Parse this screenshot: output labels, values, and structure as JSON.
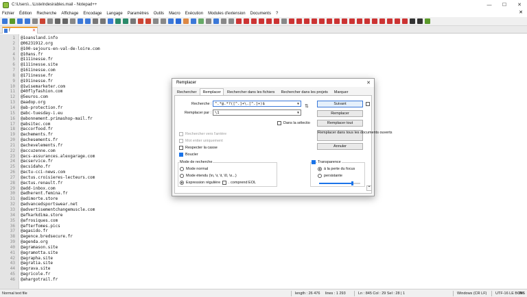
{
  "window": {
    "title": "C:\\Users\\...\\ListeIndesirables.mail - Notepad++",
    "minimize": "—",
    "maximize": "☐",
    "close": "✕"
  },
  "menu": [
    "Fichier",
    "Édition",
    "Recherche",
    "Affichage",
    "Encodage",
    "Langage",
    "Paramètres",
    "Outils",
    "Macro",
    "Exécution",
    "Modules d'extension",
    "Documents",
    "?"
  ],
  "menu_close": "✕",
  "tab": {
    "label": "f",
    "close": "✕"
  },
  "editor": {
    "lines": [
      {
        "n": "1",
        "t": "@1oansland.info"
      },
      {
        "n": "2",
        "t": "@06231912.org"
      },
      {
        "n": "3",
        "t": "@100-sejours-en-val-de-loire.com"
      },
      {
        "n": "4",
        "t": "@10ans.fr"
      },
      {
        "n": "5",
        "t": "@111inesse.fr"
      },
      {
        "n": "6",
        "t": "@111inesse.site"
      },
      {
        "n": "7",
        "t": "@161inesse.com"
      },
      {
        "n": "8",
        "t": "@171inesse.fr"
      },
      {
        "n": "9",
        "t": "@191inesse.fr"
      },
      {
        "n": "10",
        "t": "@1wisemarketer.com"
      },
      {
        "n": "11",
        "t": "@40flyfashion.com"
      },
      {
        "n": "12",
        "t": "@5euros.com"
      },
      {
        "n": "13",
        "t": "@aadop.org"
      },
      {
        "n": "14",
        "t": "@ab-protection.fr"
      },
      {
        "n": "15",
        "t": "@abc-tuesday-i.eu"
      },
      {
        "n": "16",
        "t": "@abonnement.primashop-mail.fr"
      },
      {
        "n": "17",
        "t": "@absitec.com"
      },
      {
        "n": "18",
        "t": "@accorfood.fr"
      },
      {
        "n": "19",
        "t": "@achements.fr"
      },
      {
        "n": "20",
        "t": "@achesements.fr"
      },
      {
        "n": "21",
        "t": "@achevelements.fr"
      },
      {
        "n": "22",
        "t": "@accuzenne.com"
      },
      {
        "n": "23",
        "t": "@acs-assurances.alexgarage.com"
      },
      {
        "n": "24",
        "t": "@acservice.fr"
      },
      {
        "n": "25",
        "t": "@acsidaho.fr"
      },
      {
        "n": "26",
        "t": "@actu-cci-news.com"
      },
      {
        "n": "27",
        "t": "@actus.croisieres-lecteurs.com"
      },
      {
        "n": "28",
        "t": "@actus.renault.fr"
      },
      {
        "n": "29",
        "t": "@add-inbox.com"
      },
      {
        "n": "30",
        "t": "@adherent.femina.fr"
      },
      {
        "n": "31",
        "t": "@adimorte.store"
      },
      {
        "n": "32",
        "t": "@advancedsportswear.net"
      },
      {
        "n": "33",
        "t": "@advertisementchangemuscle.com"
      },
      {
        "n": "34",
        "t": "@afkarkdima.store"
      },
      {
        "n": "35",
        "t": "@afrosiques.com"
      },
      {
        "n": "36",
        "t": "@afterfomes.pics"
      },
      {
        "n": "37",
        "t": "@agasido.fr"
      },
      {
        "n": "38",
        "t": "@agence.bredsecure.fr"
      },
      {
        "n": "39",
        "t": "@agenda.org"
      },
      {
        "n": "40",
        "t": "@agramason.site"
      },
      {
        "n": "41",
        "t": "@agramotta.site"
      },
      {
        "n": "42",
        "t": "@agrapha.site"
      },
      {
        "n": "43",
        "t": "@agratia.site"
      },
      {
        "n": "44",
        "t": "@agrava.site"
      },
      {
        "n": "45",
        "t": "@agricole.fr"
      },
      {
        "n": "46",
        "t": "@ahargotrail.fr"
      }
    ]
  },
  "status": {
    "type": "Normal text file",
    "length": "length : 26 476",
    "lines": "lines : 1 293",
    "position": "Ln : 845    Col : 29    Sel : 28 | 1",
    "eol": "Windows (CR LF)",
    "encoding": "UTF-16 LE BOM",
    "mode": "INS"
  },
  "dialog": {
    "title": "Remplacer",
    "close": "✕",
    "tabs": [
      "Rechercher",
      "Remplacer",
      "Rechercher dans les fichiers",
      "Rechercher dans les projets",
      "Marquer"
    ],
    "find_label": "Recherche :",
    "find_value": "^.*@.*?([^.]+\\.[^.]+)$",
    "replace_label": "Remplacer par :",
    "replace_value": "\\1",
    "in_selection": "Dans la sélectio",
    "backward": "Rechercher vers l'arrière",
    "whole_word": "Mot entier uniquement",
    "match_case": "Respecter la casse",
    "wrap": "Boucler",
    "search_mode_title": "Mode de recherche",
    "mode_normal": "Mode normal",
    "mode_extended": "Mode étendu (\\n, \\r, \\t, \\0, \\x...)",
    "mode_regex": "Expression régulière",
    "dot_newline": ". comprend EOL",
    "btn_find_next": "Suivant",
    "btn_replace": "Remplacer",
    "btn_replace_all": "Remplacer tout",
    "btn_replace_all_docs": "Remplacer dans tous les documents ouverts",
    "btn_cancel": "Annuler",
    "transparency_title": "Transparence",
    "trans_on_lose_focus": "à la perte du focus",
    "trans_always": "persistante",
    "transparency_level": 0.8,
    "swap_icon": "⇅",
    "collapse_icon": "⌃"
  },
  "colors": {
    "accent": "#1a73e8",
    "tab_highlight": "#f0a030"
  }
}
